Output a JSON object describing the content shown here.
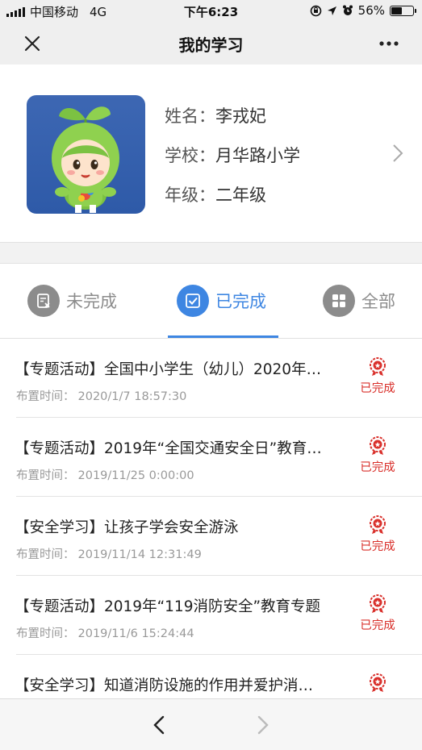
{
  "status_bar": {
    "carrier": "中国移动",
    "network": "4G",
    "time": "下午6:23",
    "battery_text": "56%",
    "battery_level": 0.56
  },
  "nav": {
    "title": "我的学习",
    "close_icon": "close-icon",
    "more_icon": "more-icon"
  },
  "profile": {
    "name_label": "姓名：",
    "name": "李戎妃",
    "school_label": "学校：",
    "school": "月华路小学",
    "grade_label": "年级：",
    "grade": "二年级"
  },
  "tabs": [
    {
      "label": "未完成",
      "icon": "incomplete-icon",
      "active": false
    },
    {
      "label": "已完成",
      "icon": "checkbox-icon",
      "active": true
    },
    {
      "label": "全部",
      "icon": "grid-icon",
      "active": false
    }
  ],
  "colors": {
    "accent": "#3e86e2",
    "inactive": "#8c8c8c",
    "status_red": "#d9302b"
  },
  "time_label": "布置时间：",
  "items": [
    {
      "title": "【专题活动】全国中小学生（幼儿）2020年…",
      "time": "2020/1/7 18:57:30",
      "status": "已完成"
    },
    {
      "title": "【专题活动】2019年“全国交通安全日”教育…",
      "time": "2019/11/25 0:00:00",
      "status": "已完成"
    },
    {
      "title": "【安全学习】让孩子学会安全游泳",
      "time": "2019/11/14 12:31:49",
      "status": "已完成"
    },
    {
      "title": "【专题活动】2019年“119消防安全”教育专题",
      "time": "2019/11/6 15:24:44",
      "status": "已完成"
    },
    {
      "title": "【安全学习】知道消防设施的作用并爱护消…",
      "time": "",
      "status": ""
    }
  ],
  "bottom_nav": {
    "back_icon": "chevron-left-icon",
    "forward_icon": "chevron-right-icon"
  }
}
